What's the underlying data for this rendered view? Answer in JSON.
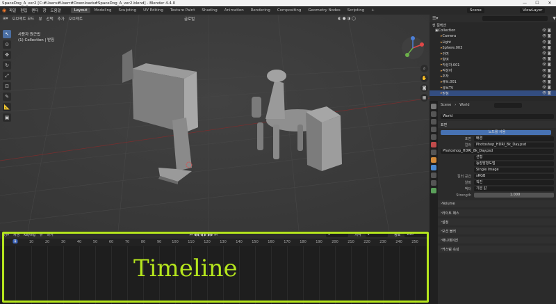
{
  "window": {
    "title": "SpaceDog_A_ver2 [C:#Users#Userr#Downloads#SpaceDog_A_ver2.blend] - Blender 4.4.0",
    "buttons": [
      "—",
      "☐",
      "✕"
    ]
  },
  "menu": [
    "파일",
    "편집",
    "렌더",
    "창",
    "도움말"
  ],
  "tabs": [
    {
      "label": "Layout",
      "active": true
    },
    {
      "label": "Modeling"
    },
    {
      "label": "Sculpting"
    },
    {
      "label": "UV Editing"
    },
    {
      "label": "Texture Paint"
    },
    {
      "label": "Shading"
    },
    {
      "label": "Animation"
    },
    {
      "label": "Rendering"
    },
    {
      "label": "Compositing"
    },
    {
      "label": "Geometry Nodes"
    },
    {
      "label": "Scripting"
    }
  ],
  "scene": "Scene",
  "viewlayer": "ViewLayer",
  "viewport": {
    "mode": "오브젝트 모드",
    "menus": [
      "뷰",
      "선택",
      "추가",
      "오브젝트"
    ],
    "orientation": "글로벌",
    "info_line1": "사용자 원근법",
    "info_line2": "(1) Collection | 받침"
  },
  "outliner": {
    "search": "",
    "root": "씬 컬렉션",
    "rows": [
      {
        "name": "Collection",
        "sel": false
      },
      {
        "name": "Camera",
        "sel": false
      },
      {
        "name": "Light",
        "sel": false
      },
      {
        "name": "Sphere.003",
        "sel": false
      },
      {
        "name": "귀여",
        "sel": false
      },
      {
        "name": "양여",
        "sel": false
      },
      {
        "name": "작성자.001",
        "sel": false
      },
      {
        "name": "작성자",
        "sel": false
      },
      {
        "name": "조작",
        "sel": false
      },
      {
        "name": "큐브.001",
        "sel": false
      },
      {
        "name": "큐브TV",
        "sel": false
      },
      {
        "name": "받침",
        "sel": true
      }
    ]
  },
  "properties": {
    "breadcrumb": [
      "Scene",
      "World"
    ],
    "world": "World",
    "section_surface": "표면",
    "use_nodes": "노드를 사용",
    "surface_label": "표면",
    "surface_value": "배경",
    "color_label": "컬러",
    "color_value": "Photoshop_HDRI_8k_Day.psd",
    "image_name": "Photoshop_HDRI_8k_Day.psd",
    "interp": "선형",
    "proj": "등장방형도법",
    "source": "Single Image",
    "colorspace_label": "컬러 공간",
    "colorspace_value": "sRGB",
    "alpha_label": "알파",
    "alpha_value": "직진",
    "vector_label": "벡터",
    "vector_value": "기본 값",
    "strength_label": "Strength",
    "strength_value": "1.000",
    "sections": [
      "Volume",
      "라이트 패스",
      "설정",
      "모션 블러",
      "애니메이션",
      "커스텀 속성"
    ]
  },
  "timeline": {
    "menus": [
      "재생",
      "Keying",
      "뷰",
      "마커"
    ],
    "current": "1",
    "start_label": "시작",
    "start": "1",
    "end_label": "종료",
    "end": "250",
    "ticks": [
      "0",
      "10",
      "20",
      "30",
      "40",
      "50",
      "60",
      "70",
      "80",
      "90",
      "100",
      "110",
      "120",
      "130",
      "140",
      "150",
      "160",
      "170",
      "180",
      "190",
      "200",
      "210",
      "220",
      "230",
      "240",
      "250"
    ],
    "frame_badge": "1"
  },
  "annotation": "Timeline",
  "colors": {
    "highlight": "#b5e61d",
    "accent": "#3a66c4"
  }
}
